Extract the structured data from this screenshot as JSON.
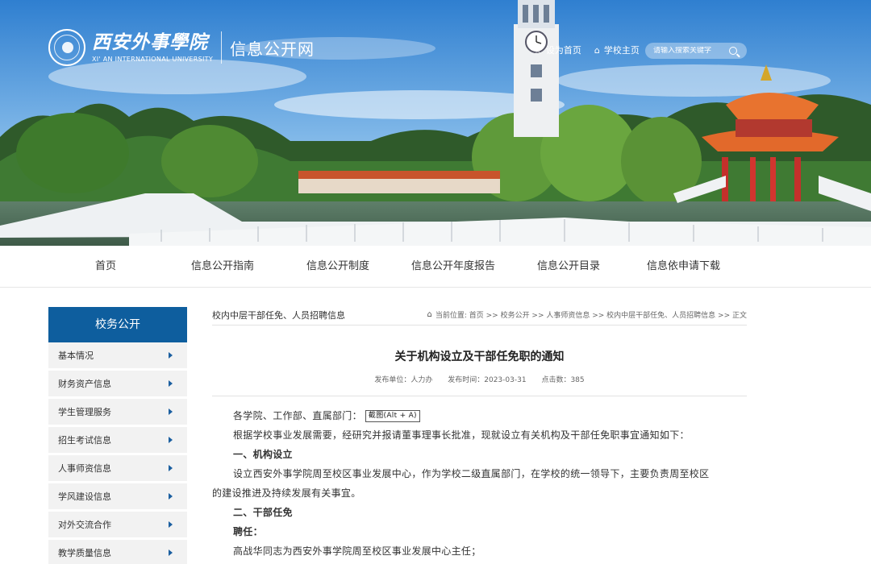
{
  "header": {
    "logo_cn": "西安外事學院",
    "logo_en": "XI' AN INTERNATIONAL UNIVERSITY",
    "site_name": "信息公开网",
    "links": [
      {
        "icon": "star-icon",
        "label": "设为首页"
      },
      {
        "icon": "home-icon",
        "label": "学校主页"
      }
    ],
    "search_placeholder": "请输入搜索关键字"
  },
  "nav": {
    "items": [
      "首页",
      "信息公开指南",
      "信息公开制度",
      "信息公开年度报告",
      "信息公开目录",
      "信息依申请下载"
    ]
  },
  "sidebar": {
    "title": "校务公开",
    "items": [
      "基本情况",
      "财务资产信息",
      "学生管理服务",
      "招生考试信息",
      "人事师资信息",
      "学风建设信息",
      "对外交流合作",
      "教学质量信息"
    ]
  },
  "main": {
    "section_title": "校内中层干部任免、人员招聘信息",
    "breadcrumb": "当前位置: 首页 >> 校务公开 >> 人事师资信息 >> 校内中层干部任免、人员招聘信息 >> 正文",
    "article": {
      "title": "关于机构设立及干部任免职的通知",
      "meta": {
        "unit": "发布单位：人力办",
        "time": "发布时间：2023-03-31",
        "clicks": "点击数：385"
      },
      "salutation": "各学院、工作部、直属部门：",
      "tooltip": "截图(Alt + A)",
      "para1": "根据学校事业发展需要，经研究并报请董事理事长批准，现就设立有关机构及干部任免职事宜通知如下：",
      "heading1": "一、机构设立",
      "para2_line1": "设立西安外事学院周至校区事业发展中心，作为学校二级直属部门，在学校的统一领导下，主要负责周至校区",
      "para2_line2": "的建设推进及持续发展有关事宜。",
      "heading2": "二、干部任免",
      "sub_heading": "聘任：",
      "para3": "高战华同志为西安外事学院周至校区事业发展中心主任；"
    }
  }
}
